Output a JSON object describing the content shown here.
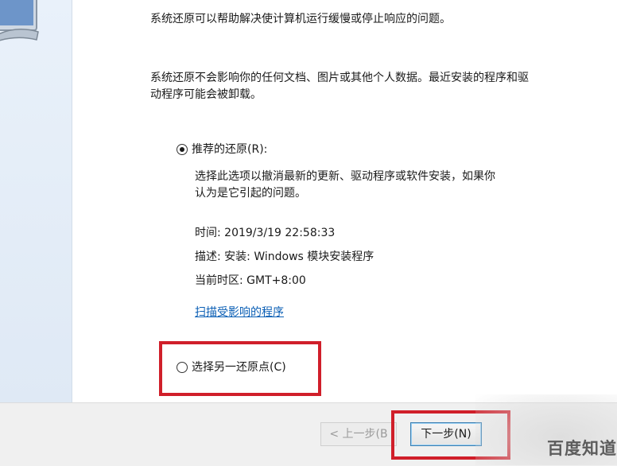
{
  "intro": {
    "line1": "系统还原可以帮助解决使计算机运行缓慢或停止响应的问题。",
    "line2a": "系统还原不会影响你的任何文档、图片或其他个人数据。最近安装的程序和驱",
    "line2b": "动程序可能会被卸载。"
  },
  "recommended": {
    "label": "推荐的还原(R):",
    "selected": true,
    "desc_a": "选择此选项以撤消最新的更新、驱动程序或软件安装，如果你",
    "desc_b": "认为是它引起的问题。",
    "time": "时间: 2019/3/19 22:58:33",
    "description": "描述: 安装: Windows 模块安装程序",
    "timezone": "当前时区: GMT+8:00",
    "scan_link": "扫描受影响的程序"
  },
  "other": {
    "label": "选择另一还原点(C)",
    "selected": false
  },
  "footer": {
    "back_label": "< 上一步(B",
    "next_label": "下一步(N)"
  },
  "watermark": "百度知道",
  "colors": {
    "highlight": "#d01f2a",
    "link": "#0b5fb5",
    "side_panel": "#e9f1fa"
  }
}
